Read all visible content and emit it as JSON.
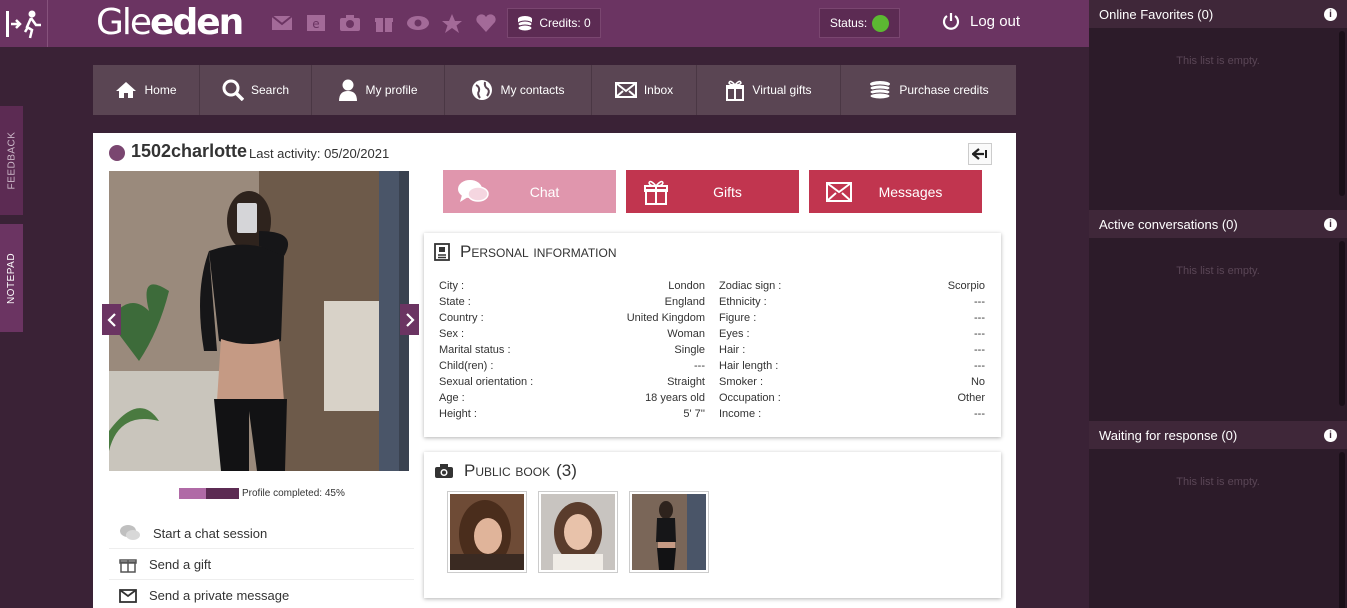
{
  "topbar": {
    "logo": {
      "light": "Gle",
      "bold": "eden"
    },
    "credits_label": "Credits: 0",
    "status_label": "Status:",
    "logout_label": "Log out",
    "icons": [
      "envelope-icon",
      "e-icon",
      "camera-icon",
      "gift-icon",
      "eye-icon",
      "star-icon",
      "heart-icon"
    ]
  },
  "sidetabs": {
    "feedback": "FEEDBACK",
    "notepad": "NOTEPAD"
  },
  "nav": [
    {
      "label": "Home",
      "icon": "home-icon"
    },
    {
      "label": "Search",
      "icon": "search-icon"
    },
    {
      "label": "My profile",
      "icon": "user-icon"
    },
    {
      "label": "My contacts",
      "icon": "globe-icon"
    },
    {
      "label": "Inbox",
      "icon": "envelope-icon"
    },
    {
      "label": "Virtual gifts",
      "icon": "gift-icon"
    },
    {
      "label": "Purchase credits",
      "icon": "coins-icon"
    }
  ],
  "profile": {
    "username": "1502charlotte",
    "last_activity": "Last activity: 05/20/2021",
    "progress_label": "Profile completed: 45%",
    "progress_percent": 45
  },
  "actions": {
    "chat": "Chat",
    "gifts": "Gifts",
    "messages": "Messages"
  },
  "side_actions": [
    {
      "label": "Start a chat session",
      "icon": "chat-bubble-icon"
    },
    {
      "label": "Send a gift",
      "icon": "gift-icon"
    },
    {
      "label": "Send a private message",
      "icon": "envelope-icon"
    }
  ],
  "personal_info": {
    "title": "Personal information",
    "left": [
      {
        "label": "City :",
        "value": "London"
      },
      {
        "label": "State :",
        "value": "England"
      },
      {
        "label": "Country :",
        "value": "United Kingdom"
      },
      {
        "label": "Sex :",
        "value": "Woman"
      },
      {
        "label": "Marital status :",
        "value": "Single"
      },
      {
        "label": "Child(ren) :",
        "value": "---"
      },
      {
        "label": "Sexual orientation :",
        "value": "Straight"
      },
      {
        "label": "Age :",
        "value": "18 years old"
      },
      {
        "label": "Height :",
        "value": "5' 7''"
      }
    ],
    "right": [
      {
        "label": "Zodiac sign :",
        "value": "Scorpio"
      },
      {
        "label": "Ethnicity :",
        "value": "---"
      },
      {
        "label": "Figure :",
        "value": "---"
      },
      {
        "label": "Eyes :",
        "value": "---"
      },
      {
        "label": "Hair :",
        "value": "---"
      },
      {
        "label": "Hair length :",
        "value": "---"
      },
      {
        "label": "Smoker :",
        "value": "No"
      },
      {
        "label": "Occupation :",
        "value": "Other"
      },
      {
        "label": "Income :",
        "value": "---"
      }
    ]
  },
  "public_book": {
    "title": "Public book",
    "count": "(3)"
  },
  "sidebar": [
    {
      "title": "Online Favorites (0)",
      "empty": "This list is empty."
    },
    {
      "title": "Active conversations (0)",
      "empty": "This list is empty."
    },
    {
      "title": "Waiting for response (0)",
      "empty": "This list is empty."
    }
  ],
  "colors": {
    "brand": "#6b3462",
    "accent": "#c1354f",
    "chat": "#e096ad",
    "online": "#5cb832"
  }
}
